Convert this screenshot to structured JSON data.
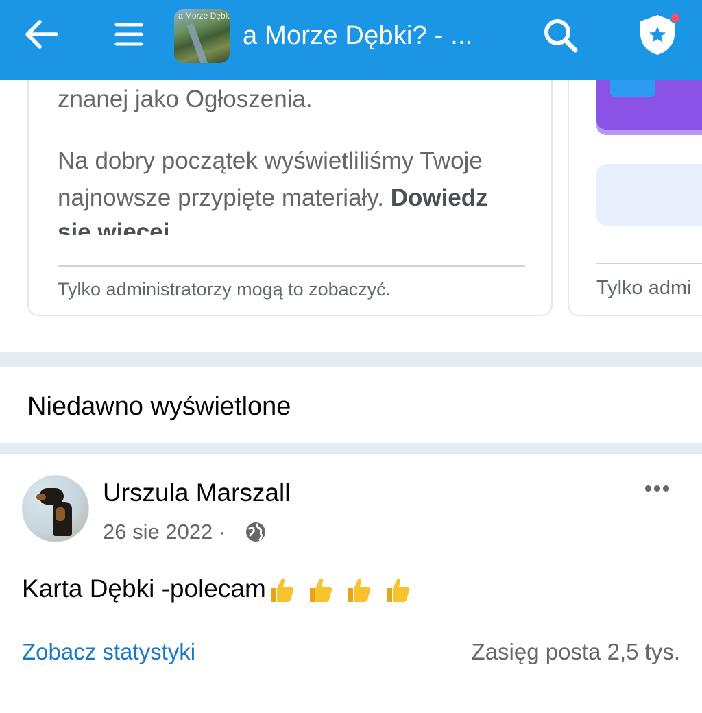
{
  "header": {
    "title": "a Morze Dębki? - ...",
    "thumbnail_text": "a Morze Dębk",
    "icons": {
      "back": "arrow-left-icon",
      "menu": "hamburger-menu-icon",
      "search": "search-icon",
      "admin": "admin-shield-star-icon"
    },
    "colors": {
      "bar": "#1a96e5",
      "notification_dot": "#ff4d5e"
    }
  },
  "announcement_card": {
    "line1": "znanej jako Ogłoszenia.",
    "line2": "Na dobry początek wyświetliliśmy Twoje",
    "line3_normal": "najnowsze przypięte materiały.",
    "line3_bold": "Dowiedz",
    "line4": "się więcej",
    "footer": "Tylko administratorzy mogą to zobaczyć."
  },
  "secondary_card": {
    "footer": "Tylko admi"
  },
  "recent_section": {
    "title": "Niedawno wyświetlone"
  },
  "post": {
    "author": "Urszula Marszall",
    "date": "26 sie 2022 ·",
    "privacy_icon": "globe-icon",
    "more_icon": "more-horizontal-icon",
    "text": "Karta Dębki -polecam",
    "emoji": [
      "👍",
      "👍",
      "👍",
      "👍"
    ],
    "stats_link": "Zobacz statystyki",
    "reach": "Zasięg posta 2,5 tys."
  }
}
